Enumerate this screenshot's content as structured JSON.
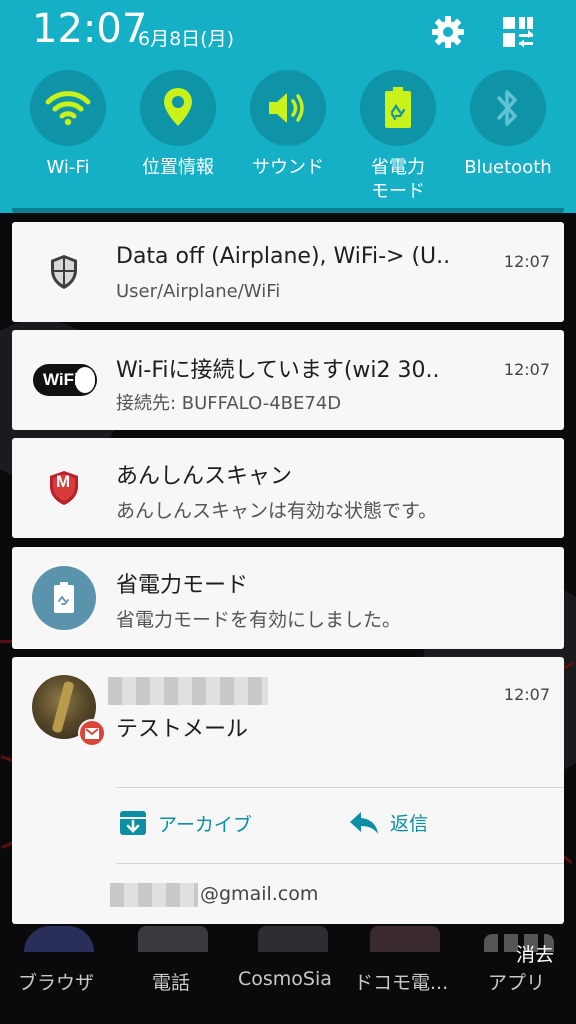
{
  "status": {
    "time": "12:07",
    "date": "6月8日(月)"
  },
  "quick_settings": [
    {
      "label": "Wi-Fi",
      "icon": "wifi-icon"
    },
    {
      "label": "位置情報",
      "icon": "location-pin-icon"
    },
    {
      "label": "サウンド",
      "icon": "speaker-icon"
    },
    {
      "label": "省電力\nモード",
      "icon": "battery-saver-icon"
    },
    {
      "label": "Bluetooth",
      "icon": "bluetooth-icon"
    }
  ],
  "notifications": [
    {
      "title": "Data off (Airplane), WiFi-> (U..",
      "subtitle": "User/Airplane/WiFi",
      "time": "12:07",
      "icon": "shield-icon"
    },
    {
      "title": "Wi-Fiに接続しています(wi2 30..",
      "subtitle": "接続先: BUFFALO-4BE74D",
      "time": "12:07",
      "icon": "wifi-logo-icon",
      "logo_text": "WiFi"
    },
    {
      "title": "あんしんスキャン",
      "subtitle": "あんしんスキャンは有効な状態です。",
      "time": "",
      "icon": "mcafee-shield-icon",
      "logo_text": "M"
    },
    {
      "title": "省電力モード",
      "subtitle": "省電力モードを有効にしました。",
      "time": "",
      "icon": "battery-saver-icon"
    }
  ],
  "email": {
    "time": "12:07",
    "subject": "テストメール",
    "archive_label": "アーカイブ",
    "reply_label": "返信",
    "account_suffix": "@gmail.com"
  },
  "dock": [
    {
      "label": "ブラウザ"
    },
    {
      "label": "電話"
    },
    {
      "label": "CosmoSia"
    },
    {
      "label": "ドコモ電..."
    },
    {
      "label": "アプリ"
    }
  ],
  "clear_label": "消去",
  "colors": {
    "panel": "#16b0c6",
    "circle": "#0f93a7",
    "active_icon": "#c9f21b",
    "inactive_icon": "#5fc3d3",
    "accent": "#0c8fa3"
  }
}
